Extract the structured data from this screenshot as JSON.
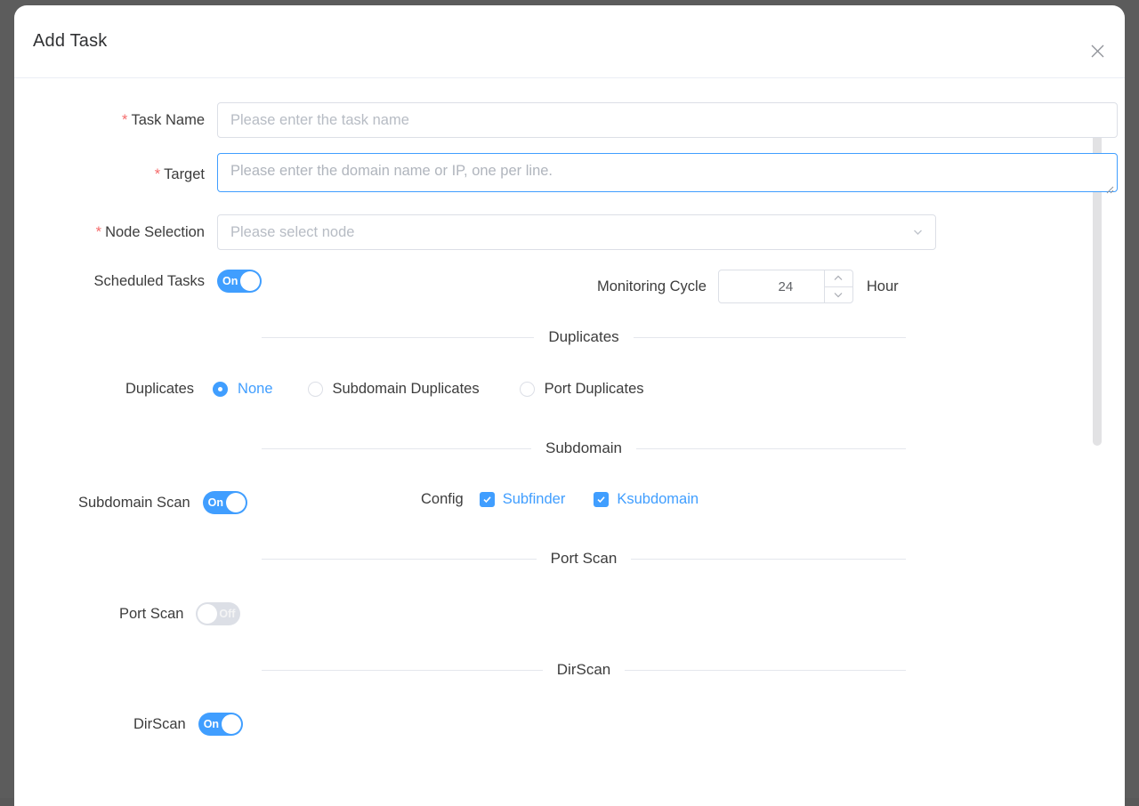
{
  "dialog": {
    "title": "Add Task",
    "close_icon": "close-icon"
  },
  "form": {
    "task_name": {
      "label": "Task Name",
      "required_marker": "*",
      "placeholder": "Please enter the task name",
      "value": ""
    },
    "target": {
      "label": "Target",
      "required_marker": "*",
      "placeholder": "Please enter the domain name or IP, one per line.",
      "value": ""
    },
    "node_selection": {
      "label": "Node Selection",
      "required_marker": "*",
      "placeholder": "Please select node",
      "value": "",
      "arrow_icon": "chevron-down-icon"
    },
    "scheduled_tasks": {
      "label": "Scheduled Tasks",
      "state": "On"
    },
    "monitoring_cycle": {
      "label": "Monitoring Cycle",
      "value": "24",
      "unit": "Hour"
    }
  },
  "sections": {
    "duplicates": {
      "caption": "Duplicates",
      "row_label": "Duplicates",
      "options": [
        {
          "label": "None",
          "checked": true
        },
        {
          "label": "Subdomain Duplicates",
          "checked": false
        },
        {
          "label": "Port Duplicates",
          "checked": false
        }
      ]
    },
    "subdomain": {
      "caption": "Subdomain",
      "row_label": "Subdomain Scan",
      "state": "On",
      "config_label": "Config",
      "config_options": [
        {
          "label": "Subfinder",
          "checked": true
        },
        {
          "label": "Ksubdomain",
          "checked": true
        }
      ]
    },
    "port_scan": {
      "caption": "Port Scan",
      "row_label": "Port Scan",
      "state": "Off"
    },
    "dirscan": {
      "caption": "DirScan",
      "row_label": "DirScan",
      "state": "On"
    }
  },
  "colors": {
    "accent": "#409eff",
    "required": "#f56c6c",
    "text": "#3c3c3c",
    "placeholder": "#b7bcc4",
    "border": "#dcdfe6",
    "off_track": "#dcdfe6"
  }
}
